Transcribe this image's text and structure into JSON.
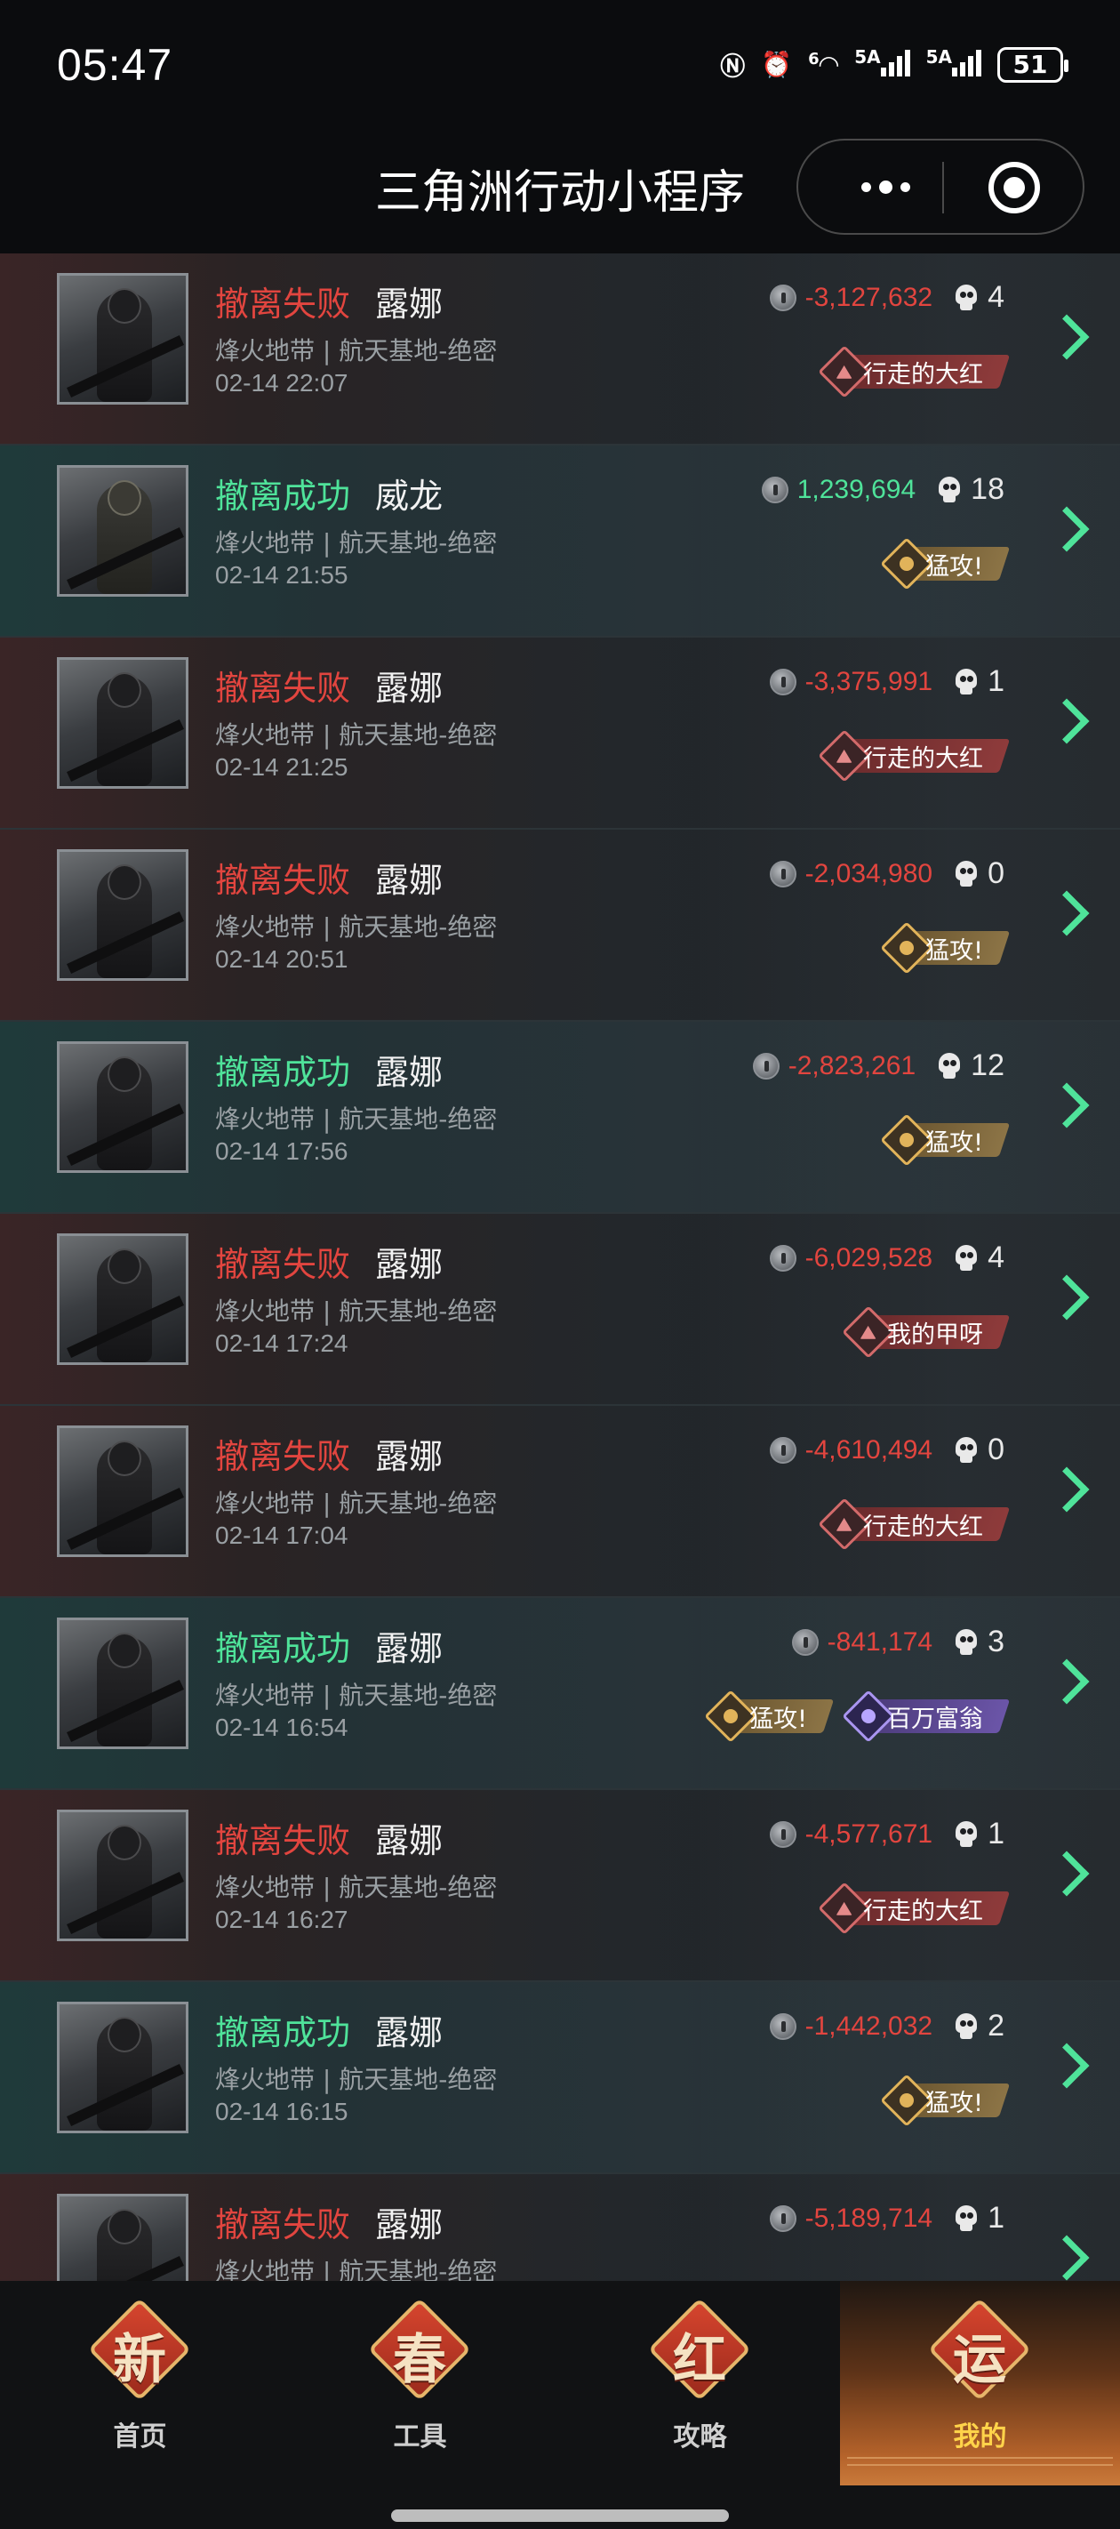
{
  "status_bar": {
    "time": "05:47",
    "network_1": "6",
    "network_2": "5A",
    "network_3": "5A",
    "battery": "51"
  },
  "titlebar": {
    "title": "三角洲行动小程序"
  },
  "records": [
    {
      "result": "撤离失败",
      "result_type": "fail",
      "operator": "露娜",
      "map": "烽火地带 | 航天基地-绝密",
      "time": "02-14 22:07",
      "value": "-3,127,632",
      "value_sign": "neg",
      "kills": "4",
      "badges": [
        {
          "label": "行走的大红",
          "style": "red"
        }
      ]
    },
    {
      "result": "撤离成功",
      "result_type": "success",
      "operator": "威龙",
      "map": "烽火地带 | 航天基地-绝密",
      "time": "02-14 21:55",
      "value": "1,239,694",
      "value_sign": "pos",
      "kills": "18",
      "badges": [
        {
          "label": "猛攻!",
          "style": "gold"
        }
      ]
    },
    {
      "result": "撤离失败",
      "result_type": "fail",
      "operator": "露娜",
      "map": "烽火地带 | 航天基地-绝密",
      "time": "02-14 21:25",
      "value": "-3,375,991",
      "value_sign": "neg",
      "kills": "1",
      "badges": [
        {
          "label": "行走的大红",
          "style": "red"
        }
      ]
    },
    {
      "result": "撤离失败",
      "result_type": "fail",
      "operator": "露娜",
      "map": "烽火地带 | 航天基地-绝密",
      "time": "02-14 20:51",
      "value": "-2,034,980",
      "value_sign": "neg",
      "kills": "0",
      "badges": [
        {
          "label": "猛攻!",
          "style": "gold"
        }
      ]
    },
    {
      "result": "撤离成功",
      "result_type": "success",
      "operator": "露娜",
      "map": "烽火地带 | 航天基地-绝密",
      "time": "02-14 17:56",
      "value": "-2,823,261",
      "value_sign": "neg",
      "kills": "12",
      "badges": [
        {
          "label": "猛攻!",
          "style": "gold"
        }
      ]
    },
    {
      "result": "撤离失败",
      "result_type": "fail",
      "operator": "露娜",
      "map": "烽火地带 | 航天基地-绝密",
      "time": "02-14 17:24",
      "value": "-6,029,528",
      "value_sign": "neg",
      "kills": "4",
      "badges": [
        {
          "label": "我的甲呀",
          "style": "red"
        }
      ]
    },
    {
      "result": "撤离失败",
      "result_type": "fail",
      "operator": "露娜",
      "map": "烽火地带 | 航天基地-绝密",
      "time": "02-14 17:04",
      "value": "-4,610,494",
      "value_sign": "neg",
      "kills": "0",
      "badges": [
        {
          "label": "行走的大红",
          "style": "red"
        }
      ]
    },
    {
      "result": "撤离成功",
      "result_type": "success",
      "operator": "露娜",
      "map": "烽火地带 | 航天基地-绝密",
      "time": "02-14 16:54",
      "value": "-841,174",
      "value_sign": "neg",
      "kills": "3",
      "badges": [
        {
          "label": "猛攻!",
          "style": "gold"
        },
        {
          "label": "百万富翁",
          "style": "purple"
        }
      ]
    },
    {
      "result": "撤离失败",
      "result_type": "fail",
      "operator": "露娜",
      "map": "烽火地带 | 航天基地-绝密",
      "time": "02-14 16:27",
      "value": "-4,577,671",
      "value_sign": "neg",
      "kills": "1",
      "badges": [
        {
          "label": "行走的大红",
          "style": "red"
        }
      ]
    },
    {
      "result": "撤离成功",
      "result_type": "success",
      "operator": "露娜",
      "map": "烽火地带 | 航天基地-绝密",
      "time": "02-14 16:15",
      "value": "-1,442,032",
      "value_sign": "neg",
      "kills": "2",
      "badges": [
        {
          "label": "猛攻!",
          "style": "gold"
        }
      ]
    },
    {
      "result": "撤离失败",
      "result_type": "fail",
      "operator": "露娜",
      "map": "烽火地带 | 航天基地-绝密",
      "time": "",
      "value": "-5,189,714",
      "value_sign": "neg",
      "kills": "1",
      "badges": []
    }
  ],
  "tabbar": {
    "tabs": [
      {
        "icon_char": "新",
        "label": "首页"
      },
      {
        "icon_char": "春",
        "label": "工具"
      },
      {
        "icon_char": "红",
        "label": "攻略"
      },
      {
        "icon_char": "运",
        "label": "我的",
        "active": true
      }
    ]
  },
  "colors": {
    "fail": "#e2453f",
    "success": "#4fe39a",
    "active_tab": "#ffd34a"
  }
}
